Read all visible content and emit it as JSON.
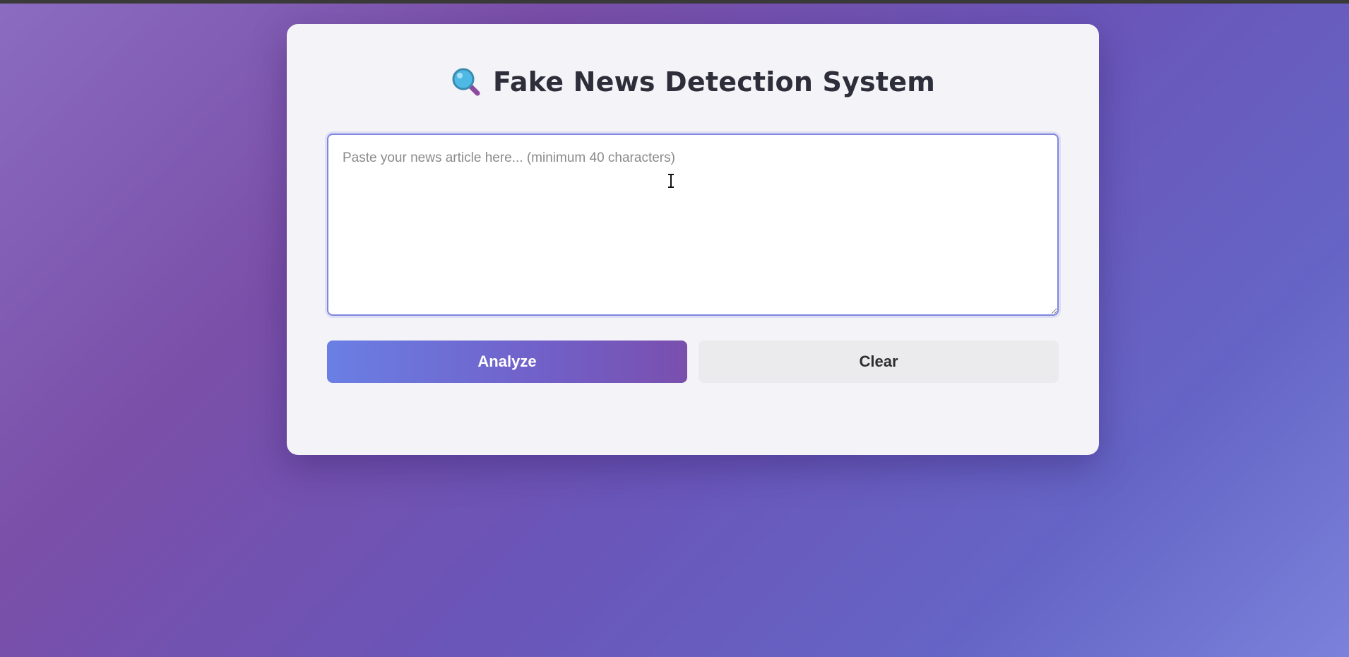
{
  "app": {
    "title": "Fake News Detection System",
    "title_icon": "magnifying-glass-icon"
  },
  "input": {
    "value": "",
    "placeholder": "Paste your news article here... (minimum 40 characters)"
  },
  "actions": {
    "analyze_label": "Analyze",
    "clear_label": "Clear"
  },
  "colors": {
    "accent_start": "#6a7fe4",
    "accent_end": "#7a4fae",
    "input_border": "#7f86e0",
    "card_background": "#f4f3f8",
    "clear_button_background": "#ebebed"
  }
}
